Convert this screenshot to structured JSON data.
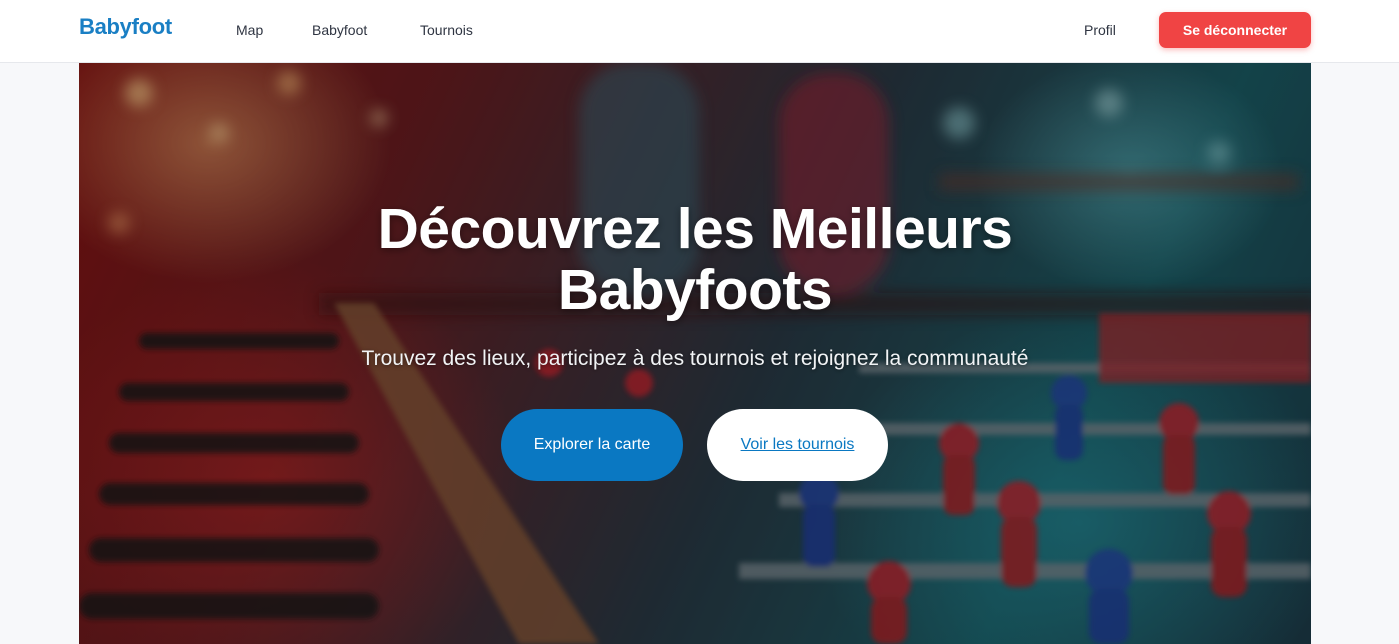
{
  "navbar": {
    "brand": "Babyfoot",
    "links": [
      {
        "label": "Map"
      },
      {
        "label": "Babyfoot"
      },
      {
        "label": "Tournois"
      }
    ],
    "profile_label": "Profil",
    "logout_label": "Se déconnecter"
  },
  "hero": {
    "title": "Découvrez les Meilleurs Babyfoots",
    "subtitle": "Trouvez des lieux, participez à des tournois et rejoignez la communauté",
    "primary_button": "Explorer la carte",
    "secondary_button": "Voir les tournois",
    "background_image": "blurred-foosball-table-in-bar"
  },
  "colors": {
    "brand": "#1a7fc4",
    "primary": "#0a78c2",
    "danger": "#f04444",
    "navbar_bg": "#ffffff",
    "page_bg": "#f7f8fa"
  }
}
